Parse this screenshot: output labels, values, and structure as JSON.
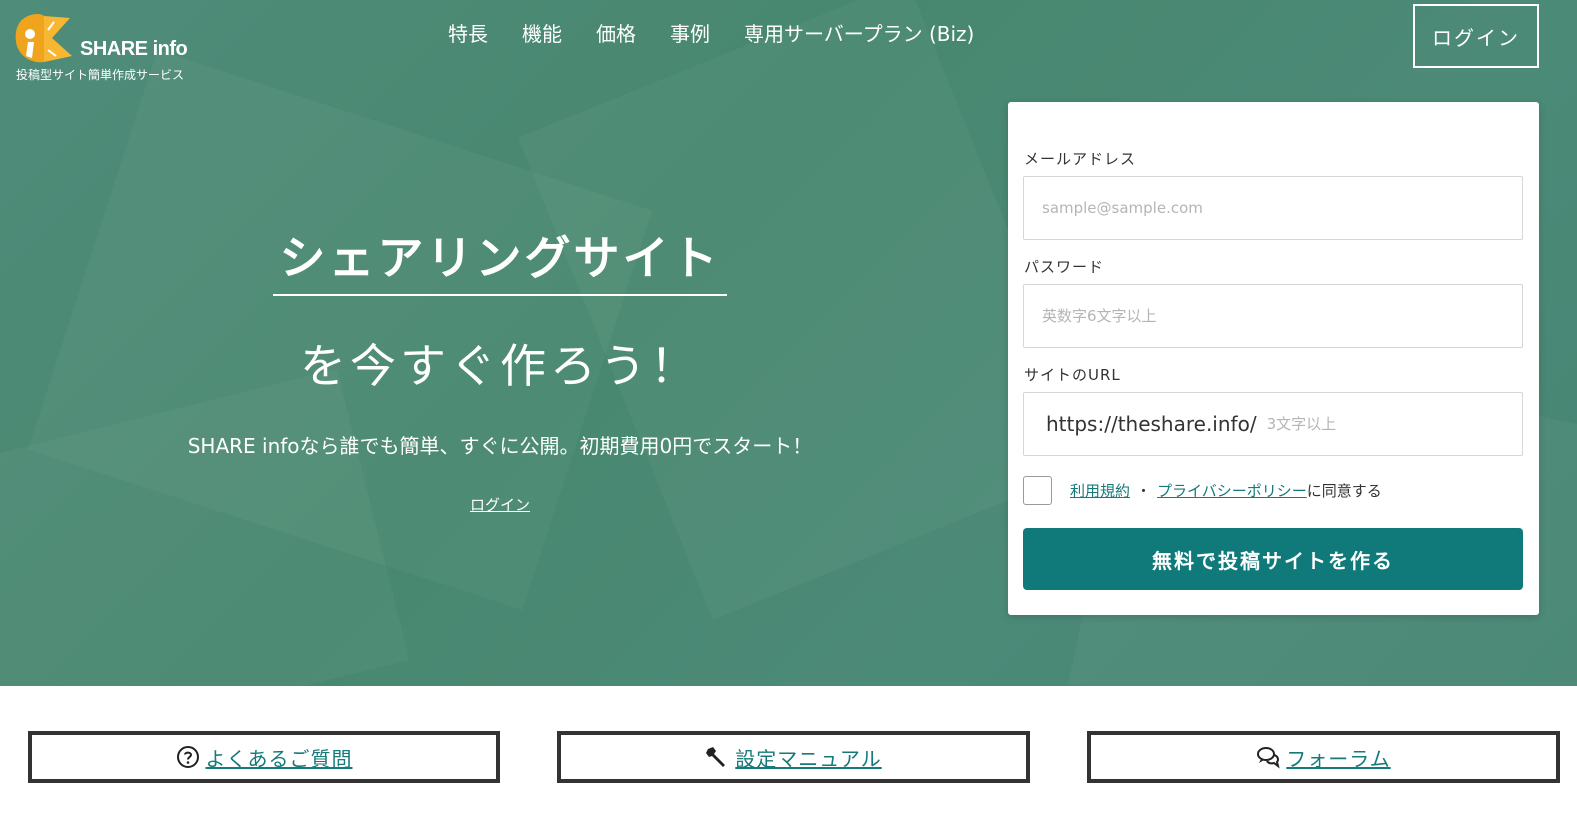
{
  "brand": {
    "name": "SHARE info",
    "tagline": "投稿型サイト簡単作成サービス",
    "colors": {
      "hero": "#4b8a78",
      "accent": "#0f7a79",
      "link": "#16797a",
      "logo_orange": "#f0a31c"
    }
  },
  "nav": {
    "items": [
      {
        "label": "特長"
      },
      {
        "label": "機能"
      },
      {
        "label": "価格"
      },
      {
        "label": "事例"
      },
      {
        "label": "専用サーバープラン (Biz)"
      }
    ],
    "login_label": "ログイン"
  },
  "hero": {
    "headline_main": "シェアリングサイト",
    "headline_sub": "を今すぐ作ろう！",
    "lead": "SHARE infoなら誰でも簡単、すぐに公開。初期費用0円でスタート！",
    "login_link": "ログイン"
  },
  "signup": {
    "email_label": "メールアドレス",
    "email_placeholder": "sample@sample.com",
    "password_label": "パスワード",
    "password_placeholder": "英数字6文字以上",
    "url_label": "サイトのURL",
    "url_prefix": "https://theshare.info/",
    "url_placeholder": "3文字以上",
    "terms_link": "利用規約",
    "terms_separator": "・",
    "privacy_link": "プライバシーポリシー",
    "agree_suffix": "に同意する",
    "submit_label": "無料で投稿サイトを作る"
  },
  "bottom_links": [
    {
      "label": " よくあるご質問",
      "icon": "question-circle-icon"
    },
    {
      "label": " 設定マニュアル",
      "icon": "wrench-icon"
    },
    {
      "label": " フォーラム",
      "icon": "chat-bubbles-icon"
    }
  ]
}
